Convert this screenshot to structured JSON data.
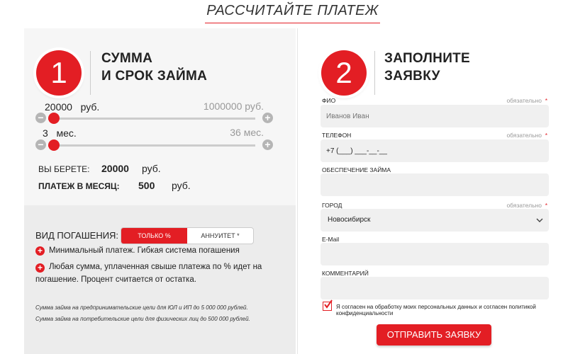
{
  "header": {
    "title": "РАССЧИТАЙТЕ ПЛАТЕЖ"
  },
  "step1": {
    "number": "1",
    "heading_line1": "СУММА",
    "heading_line2": "И СРОК ЗАЙМА",
    "amount_slider": {
      "value": "20000",
      "unit": "руб.",
      "max_label": "1000000 руб.",
      "fill_fraction": 0.0
    },
    "term_slider": {
      "value": "3",
      "unit": "мес.",
      "max_label": "36 мес.",
      "fill_fraction": 0.0
    },
    "minus_symbol": "−",
    "plus_symbol": "+",
    "you_take_label": "ВЫ БЕРЕТЕ:",
    "you_take_value": "20000",
    "you_take_unit": "руб.",
    "monthly_label": "ПЛАТЕЖ В МЕСЯЦ:",
    "monthly_value": "500",
    "monthly_unit": "руб."
  },
  "repayment": {
    "label": "ВИД ПОГАШЕНИЯ:",
    "options": [
      "ТОЛЬКО %",
      "АННУИТЕТ *"
    ],
    "selected": "ТОЛЬКО %",
    "bullets": [
      "Минимальный платеж. Гибкая система погашения",
      "Любая сумма, уплаченная свыше платежа по % идет на",
      "погашение. Процент считается от остатка."
    ],
    "notes": [
      "Сумма займа на предпринимательские цели для ЮЛ и ИП до 5 000 000 рублей.",
      "Сумма займа на потребительские цели для физических лиц до 500 000 рублей."
    ]
  },
  "step2": {
    "number": "2",
    "heading_line1": "ЗАПОЛНИТЕ",
    "heading_line2": "ЗАЯВКУ",
    "required_text": "обязательно",
    "required_star": "*",
    "fields": {
      "fio": {
        "label": "ФИО",
        "placeholder": "Иванов Иван"
      },
      "phone": {
        "label": "ТЕЛЕФОН",
        "value": "+7 (___) ___-__-__"
      },
      "collateral": {
        "label": "ОБЕСПЕЧЕНИЕ ЗАЙМА",
        "value": ""
      },
      "city": {
        "label": "ГОРОД",
        "value": "Новосибирск"
      },
      "email": {
        "label": "E-Mail",
        "value": ""
      },
      "comment": {
        "label": "КОММЕНТАРИЙ",
        "value": ""
      }
    },
    "agree_text": "Я согласен на обработку моих персональных данных и согласен политикой конфиденциальности",
    "agree_checked": true,
    "submit_label": "ОТПРАВИТЬ ЗАЯВКУ"
  },
  "colors": {
    "accent": "#e31e24",
    "panel_light": "#f6f6f6",
    "panel_gray": "#ececec",
    "field_bg": "#f0f0f0"
  }
}
